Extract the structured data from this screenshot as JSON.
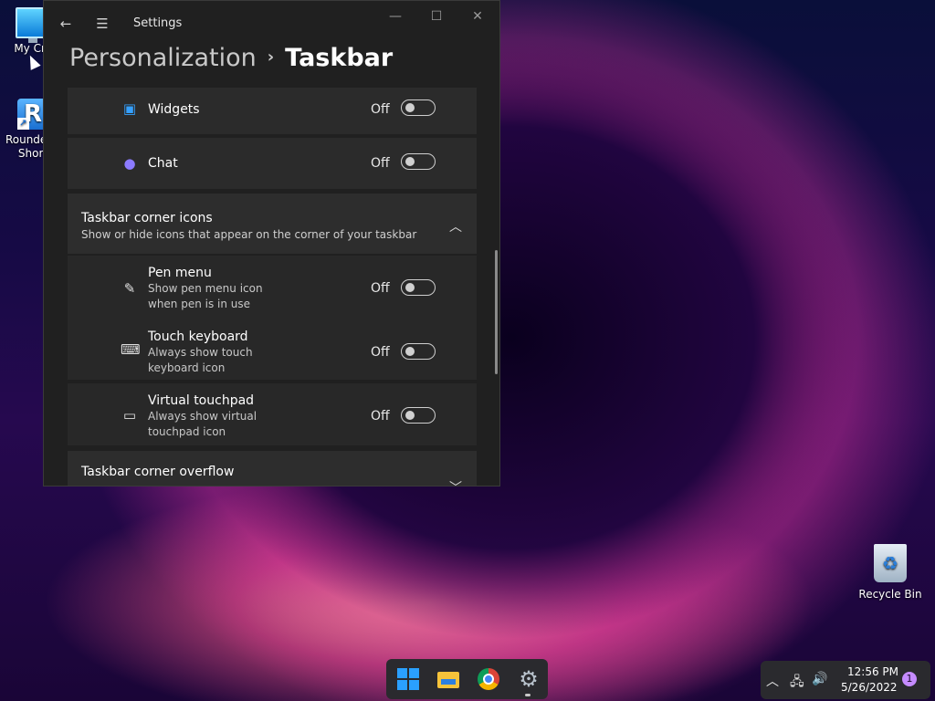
{
  "desktop": {
    "icons": [
      {
        "label": "My Cm"
      },
      {
        "label": "Roundec - Short"
      },
      {
        "label": "Recycle Bin"
      }
    ]
  },
  "window": {
    "title": "Settings",
    "breadcrumb": {
      "parent": "Personalization",
      "separator": "›",
      "current": "Taskbar"
    }
  },
  "taskbar_items": [
    {
      "label": "Widgets",
      "icon": "widgets-icon",
      "state": "Off"
    },
    {
      "label": "Chat",
      "icon": "chat-icon",
      "state": "Off"
    }
  ],
  "corner_icons_section": {
    "title": "Taskbar corner icons",
    "subtitle": "Show or hide icons that appear on the corner of your taskbar",
    "items": [
      {
        "label": "Pen menu",
        "desc": "Show pen menu icon when pen is in use",
        "icon": "pen-icon",
        "state": "Off"
      },
      {
        "label": "Touch keyboard",
        "desc": "Always show touch keyboard icon",
        "icon": "keyboard-icon",
        "state": "Off"
      },
      {
        "label": "Virtual touchpad",
        "desc": "Always show virtual touchpad icon",
        "icon": "touchpad-icon",
        "state": "Off"
      }
    ]
  },
  "overflow_section": {
    "title": "Taskbar corner overflow"
  },
  "tray": {
    "time": "12:56 PM",
    "date": "5/26/2022",
    "notifications": "1"
  }
}
